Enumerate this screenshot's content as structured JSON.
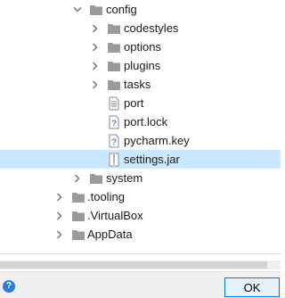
{
  "tree": {
    "items": [
      {
        "label": "config",
        "expanded": true,
        "icon": "folder-icon"
      },
      {
        "label": "codestyles",
        "expanded": false,
        "icon": "folder-icon"
      },
      {
        "label": "options",
        "expanded": false,
        "icon": "folder-icon"
      },
      {
        "label": "plugins",
        "expanded": false,
        "icon": "folder-icon"
      },
      {
        "label": "tasks",
        "expanded": false,
        "icon": "folder-icon"
      },
      {
        "label": "port",
        "icon": "text-file-icon"
      },
      {
        "label": "port.lock",
        "icon": "unknown-file-icon"
      },
      {
        "label": "pycharm.key",
        "icon": "unknown-file-icon"
      },
      {
        "label": "settings.jar",
        "icon": "archive-file-icon",
        "selected": true
      },
      {
        "label": "system",
        "expanded": false,
        "icon": "folder-icon"
      },
      {
        "label": ".tooling",
        "expanded": false,
        "icon": "folder-icon"
      },
      {
        "label": ".VirtualBox",
        "expanded": false,
        "icon": "folder-icon"
      },
      {
        "label": "AppData",
        "expanded": false,
        "icon": "folder-icon"
      }
    ],
    "selected_color": "#cce8ff",
    "folder_color": "#9a9a9a"
  },
  "dialog": {
    "help_label": "?",
    "ok_label": "OK"
  }
}
